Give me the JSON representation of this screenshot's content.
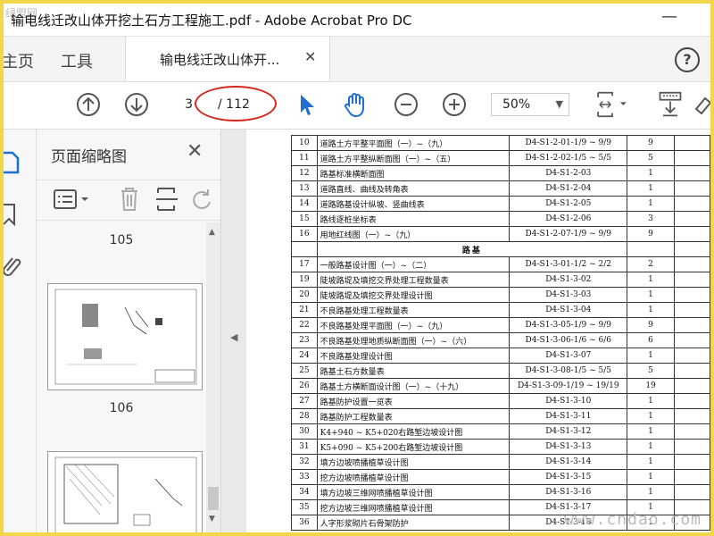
{
  "window": {
    "title": "输电线迁改山体开挖土石方工程施工.pdf - Adobe Acrobat Pro DC",
    "minimize": "—"
  },
  "tabs": {
    "home": "主页",
    "tools": "工具",
    "document": "输电线迁改山体开...",
    "close": "✕",
    "help": "?"
  },
  "toolbar": {
    "current_page": "3",
    "page_total": "/ 112",
    "zoom": "50%"
  },
  "panel": {
    "title": "页面缩略图",
    "close": "✕",
    "labels": [
      "105",
      "106"
    ]
  },
  "document": {
    "rows": [
      [
        "10",
        "道路土方平整平面图（一）~（九）",
        "D4-S1-2-01-1/9 ~ 9/9",
        "9"
      ],
      [
        "11",
        "道路土方平整纵断面图（一）~（五）",
        "D4-S1-2-02-1/5 ~ 5/5",
        "5"
      ],
      [
        "12",
        "路基标准横断面图",
        "D4-S1-2-03",
        "1"
      ],
      [
        "13",
        "道路直线、曲线及转角表",
        "D4-S1-2-04",
        "1"
      ],
      [
        "14",
        "道路路基设计纵坡、竖曲线表",
        "D4-S1-2-05",
        "1"
      ],
      [
        "15",
        "路线逐桩坐标表",
        "D4-S1-2-06",
        "3"
      ],
      [
        "16",
        "用地红线图（一）~（九）",
        "D4-S1-2-07-1/9 ~ 9/9",
        "9"
      ]
    ],
    "section": "路基",
    "rows2": [
      [
        "17",
        "一般路基设计图（一）~（二）",
        "D4-S1-3-01-1/2 ~ 2/2",
        "2"
      ],
      [
        "19",
        "陡坡路堤及填挖交界处理工程数量表",
        "D4-S1-3-02",
        "1"
      ],
      [
        "20",
        "陡坡路堤及填挖交界处理设计图",
        "D4-S1-3-03",
        "1"
      ],
      [
        "21",
        "不良路基处理工程数量表",
        "D4-S1-3-04",
        "1"
      ],
      [
        "22",
        "不良路基处理平面图（一）~（九）",
        "D4-S1-3-05-1/9 ~ 9/9",
        "9"
      ],
      [
        "23",
        "不良路基处理地质纵断面图（一）~（六）",
        "D4-S1-3-06-1/6 ~ 6/6",
        "6"
      ],
      [
        "24",
        "不良路基处理设计图",
        "D4-S1-3-07",
        "1"
      ],
      [
        "25",
        "路基土石方数量表",
        "D4-S1-3-08-1/5 ~ 5/5",
        "5"
      ],
      [
        "26",
        "路基土方横断面设计图（一）~（十九）",
        "D4-S1-3-09-1/19 ~ 19/19",
        "19"
      ],
      [
        "27",
        "路基防护设置一览表",
        "D4-S1-3-10",
        "1"
      ],
      [
        "28",
        "路基防护工程数量表",
        "D4-S1-3-11",
        "1"
      ],
      [
        "30",
        "K4+940 ~ K5+020右路堑边坡设计图",
        "D4-S1-3-12",
        "1"
      ],
      [
        "31",
        "K5+090 ~ K5+200右路堑边坡设计图",
        "D4-S1-3-13",
        "1"
      ],
      [
        "32",
        "填方边坡喷播植草设计图",
        "D4-S1-3-14",
        "1"
      ],
      [
        "33",
        "挖方边坡喷播植草设计图",
        "D4-S1-3-15",
        "1"
      ],
      [
        "34",
        "填方边坡三维网喷播植草设计图",
        "D4-S1-3-16",
        "1"
      ],
      [
        "35",
        "挖方边坡三维网喷播植草设计图",
        "D4-S1-3-17",
        "1"
      ],
      [
        "36",
        "人字形浆砌片石骨架防护",
        "D4-S1-3-18",
        "1"
      ]
    ],
    "watermark": "www.cndao.com",
    "corner_mark": "绿盟网"
  },
  "colors": {
    "border": "#f0d84a",
    "accent": "#1f6fd1",
    "annotation": "#d7261e"
  }
}
